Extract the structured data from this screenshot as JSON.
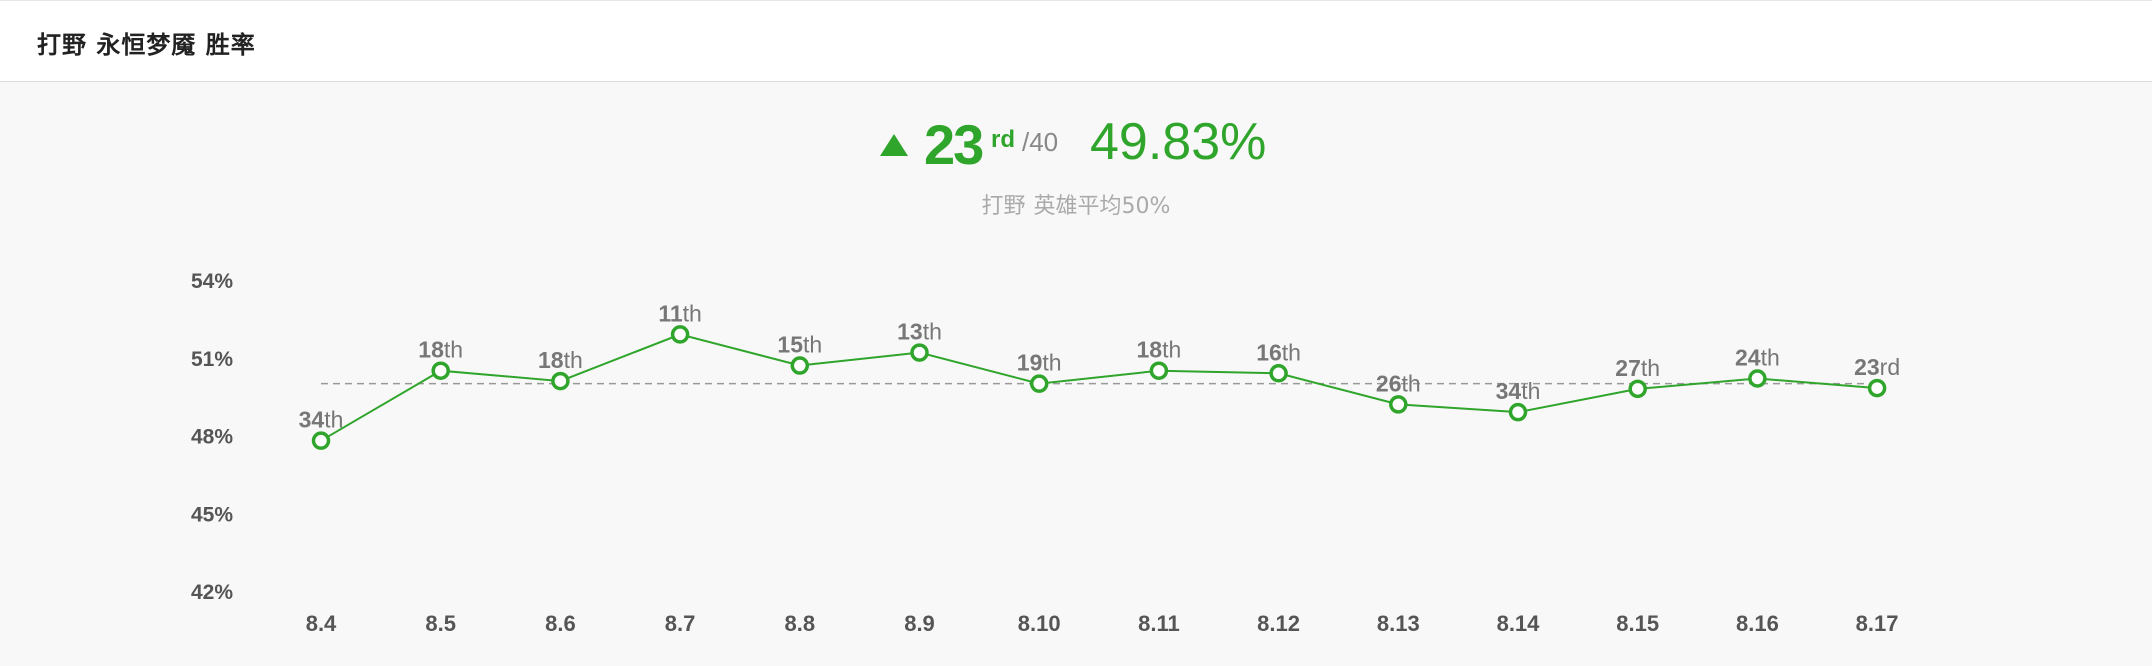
{
  "header": {
    "title": "打野 永恒梦魇 胜率"
  },
  "summary": {
    "rank": "23",
    "rank_suffix": "rd",
    "rank_total": "/40",
    "win_rate": "49.83%",
    "avg_role": "打野",
    "avg_text": "英雄平均50%",
    "trend": "up",
    "accent_color": "#2fa52b"
  },
  "chart_data": {
    "type": "line",
    "title": "",
    "xlabel": "",
    "ylabel": "",
    "categories": [
      "8.4",
      "8.5",
      "8.6",
      "8.7",
      "8.8",
      "8.9",
      "8.10",
      "8.11",
      "8.12",
      "8.13",
      "8.14",
      "8.15",
      "8.16",
      "8.17"
    ],
    "series": [
      {
        "values": [
          47.8,
          50.5,
          50.1,
          51.9,
          50.7,
          51.2,
          50.0,
          50.5,
          50.4,
          49.2,
          48.9,
          49.8,
          50.2,
          49.83
        ],
        "ranks": [
          "34th",
          "18th",
          "18th",
          "11th",
          "15th",
          "13th",
          "19th",
          "18th",
          "16th",
          "26th",
          "34th",
          "27th",
          "24th",
          "23rd"
        ],
        "color": "#2fa52b"
      }
    ],
    "reference_line": {
      "value": 50,
      "style": "dashed",
      "color": "#999999"
    },
    "ylim": [
      42,
      54
    ],
    "yticks": [
      "54%",
      "51%",
      "48%",
      "45%",
      "42%"
    ],
    "ytick_values": [
      54,
      51,
      48,
      45,
      42
    ],
    "grid": false,
    "legend": "none"
  }
}
